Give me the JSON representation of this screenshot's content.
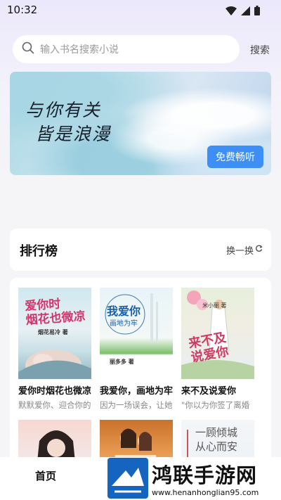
{
  "status_bar": {
    "time": "10:32",
    "icons": [
      "wifi-icon",
      "signal-icon",
      "battery-icon"
    ]
  },
  "search": {
    "placeholder": "输入书名搜索小说",
    "button_label": "搜索"
  },
  "banner": {
    "title_line1": "与你有关",
    "title_line2": "皆是浪漫",
    "button_label": "免费畅听",
    "accent_color": "#3d8ff5"
  },
  "ranking": {
    "title": "排行榜",
    "switch_label": "换一换"
  },
  "books": [
    {
      "title": "爱你时烟花也微凉",
      "desc": "默默爱你、迎合你的",
      "cover_text": "爱你时\n烟花也微凉",
      "cover_author": "烟花易冷 著"
    },
    {
      "title": "我爱你，画地为牢",
      "desc": "因为一场误会，让她",
      "cover_text": "我爱你",
      "cover_sub": "画地为牢",
      "cover_author": "丽多多 著"
    },
    {
      "title": "来不及说爱你",
      "desc": "\"你以为你签了离婚",
      "cover_text": "来不及\n说爱你",
      "cover_author": "米小丽 著"
    },
    {
      "title": "",
      "desc": "",
      "cover_text": ""
    },
    {
      "title": "",
      "desc": "",
      "cover_text": ""
    },
    {
      "title": "",
      "desc": "",
      "cover_text": "一顾倾城\n从心而安"
    }
  ],
  "tabbar": {
    "home_label": "首页"
  },
  "watermark": {
    "title": "鸿联手游网",
    "url": "www.henanhonglian95.com"
  }
}
